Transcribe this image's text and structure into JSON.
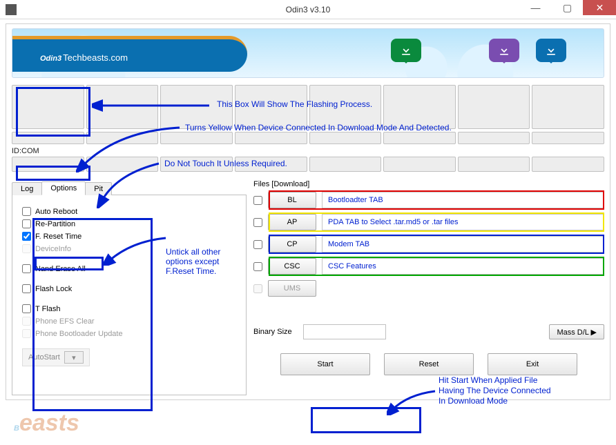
{
  "window": {
    "title": "Odin3 v3.10"
  },
  "banner": {
    "brand": "Odin3",
    "brand_sub": "Techbeasts.com"
  },
  "idcom_label": "ID:COM",
  "tabs": {
    "log": "Log",
    "options": "Options",
    "pit": "Pit"
  },
  "options": {
    "auto_reboot": "Auto Reboot",
    "re_partition": "Re-Partition",
    "f_reset_time": "F. Reset Time",
    "device_info": "DeviceInfo",
    "nand_erase_all": "Nand Erase All",
    "flash_lock": "Flash Lock",
    "t_flash": "T Flash",
    "phone_efs_clear": "Phone EFS Clear",
    "phone_bootloader_update": "Phone Bootloader Update",
    "autostart": "AutoStart"
  },
  "files_label": "Files [Download]",
  "files": {
    "bl": {
      "btn": "BL",
      "desc": "Bootloadter TAB"
    },
    "ap": {
      "btn": "AP",
      "desc": "PDA TAB to Select .tar.md5 or .tar files"
    },
    "cp": {
      "btn": "CP",
      "desc": "Modem TAB"
    },
    "csc": {
      "btn": "CSC",
      "desc": "CSC Features"
    },
    "ums": {
      "btn": "UMS",
      "desc": ""
    }
  },
  "binary_size_label": "Binary Size",
  "mass_dl_label": "Mass D/L ▶",
  "buttons": {
    "start": "Start",
    "reset": "Reset",
    "exit": "Exit"
  },
  "annotations": {
    "flashing_process": "This Box Will Show The Flashing Process.",
    "yellow_connected": "Turns Yellow When Device Connected In Download Mode And Detected.",
    "do_not_touch": "Do Not Touch It Unless Required.",
    "untick_others": "Untick all other options except F.Reset Time.",
    "hit_start_1": "Hit Start When Applied File",
    "hit_start_2": "Having The Device Connected",
    "hit_start_3": "In Download Mode"
  },
  "watermark": "Beasts"
}
